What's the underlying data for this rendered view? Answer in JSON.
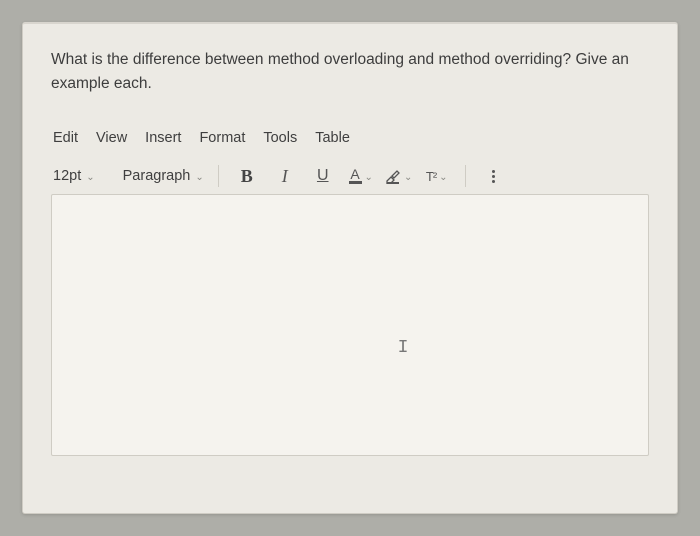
{
  "question": {
    "text": "What is the difference between method overloading and method overriding? Give an example each."
  },
  "menu": {
    "items": [
      "Edit",
      "View",
      "Insert",
      "Format",
      "Tools",
      "Table"
    ]
  },
  "toolbar": {
    "font_size": "12pt",
    "style": "Paragraph",
    "bold": "B",
    "italic": "I",
    "underline": "U",
    "text_color": "A",
    "superscript": "T²"
  },
  "editor": {
    "caret_glyph": "I"
  }
}
